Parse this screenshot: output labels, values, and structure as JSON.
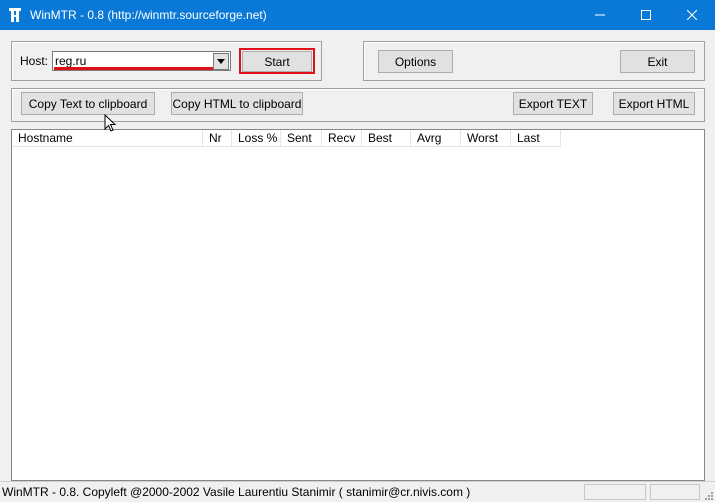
{
  "window": {
    "title": "WinMTR - 0.8 (http://winmtr.sourceforge.net)",
    "icons": {
      "app": "winmtr-app-icon",
      "minimize": "minimize-icon",
      "maximize": "maximize-icon",
      "close": "close-icon"
    },
    "colors": {
      "titlebar": "#0a78d7",
      "highlight": "#e0101a"
    }
  },
  "host": {
    "label": "Host:",
    "value": "reg.ru",
    "dropdown_icon": "chevron-down-icon"
  },
  "buttons": {
    "start": "Start",
    "options": "Options",
    "exit": "Exit",
    "copy_text": "Copy Text to clipboard",
    "copy_html": "Copy HTML to clipboard",
    "export_text": "Export TEXT",
    "export_html": "Export HTML"
  },
  "table": {
    "columns": [
      "Hostname",
      "Nr",
      "Loss %",
      "Sent",
      "Recv",
      "Best",
      "Avrg",
      "Worst",
      "Last"
    ],
    "rows": []
  },
  "status": {
    "text": "WinMTR - 0.8. Copyleft @2000-2002 Vasile Laurentiu Stanimir  ( stanimir@cr.nivis.com )"
  }
}
